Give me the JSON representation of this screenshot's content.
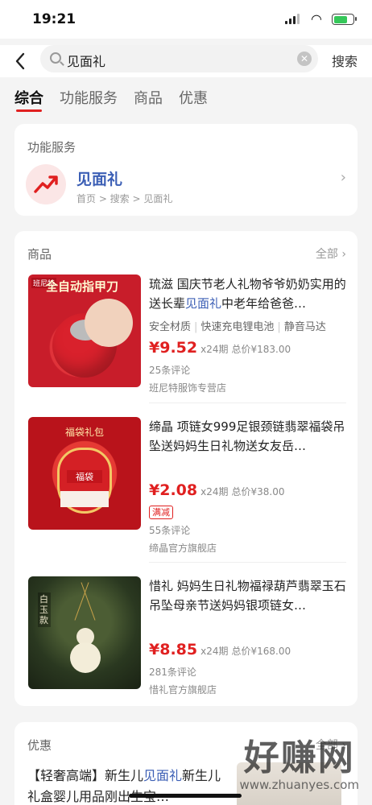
{
  "status_bar": {
    "time": "19:21"
  },
  "search": {
    "query": "见面礼",
    "button": "搜索"
  },
  "tabs": [
    {
      "label": "综合",
      "active": true
    },
    {
      "label": "功能服务",
      "active": false
    },
    {
      "label": "商品",
      "active": false
    },
    {
      "label": "优惠",
      "active": false
    }
  ],
  "function_service": {
    "title": "功能服务",
    "name": "见面礼",
    "breadcrumb": "首页 > 搜索 > 见面礼"
  },
  "goods": {
    "title": "商品",
    "all_label": "全部",
    "products": [
      {
        "title_before": "琉滋 国庆节老人礼物爷爷奶奶实用的送长辈",
        "title_highlight": "见面礼",
        "title_after": "中老年给爸爸…",
        "tags": [
          "安全材质",
          "快速充电锂电池",
          "静音马达"
        ],
        "price": "¥9.52",
        "installment": "x24期",
        "total": "总价¥183.00",
        "badge": "",
        "reviews": "25条评论",
        "shop": "班尼特服饰专营店",
        "thumb_text": "全自动指甲刀",
        "thumb_brand": "班尼特"
      },
      {
        "title_before": "缔晶 项链女999足银颈链翡翠福袋吊坠送妈妈生日礼物送女友岳…",
        "title_highlight": "",
        "title_after": "",
        "tags": [],
        "price": "¥2.08",
        "installment": "x24期",
        "total": "总价¥38.00",
        "badge": "满减",
        "reviews": "55条评论",
        "shop": "缔晶官方旗舰店",
        "thumb_text": "福袋礼包",
        "thumb_brand": "福袋"
      },
      {
        "title_before": "惜礼 妈妈生日礼物福禄葫芦翡翠玉石吊坠母亲节送妈妈银项链女…",
        "title_highlight": "",
        "title_after": "",
        "tags": [],
        "price": "¥8.85",
        "installment": "x24期",
        "total": "总价¥168.00",
        "badge": "",
        "reviews": "281条评论",
        "shop": "惜礼官方旗舰店",
        "thumb_text": "白玉款",
        "thumb_brand": ""
      }
    ]
  },
  "promo": {
    "title": "优惠",
    "all_label": "全部",
    "title_before": "【轻奢高端】新生儿",
    "title_highlight": "见面礼",
    "title_after": "新生儿礼盒婴儿用品刚出生宝…"
  },
  "watermark": {
    "big": "好赚网",
    "small": "www.zhuanyes.com"
  },
  "colors": {
    "accent": "#e02020",
    "link": "#3c5fb5",
    "background": "#f4f4f4"
  },
  "icons": {
    "back": "chevron-left-icon",
    "search": "search-icon",
    "clear": "clear-icon",
    "trend": "trend-up-icon",
    "chevron": "chevron-right-icon"
  }
}
